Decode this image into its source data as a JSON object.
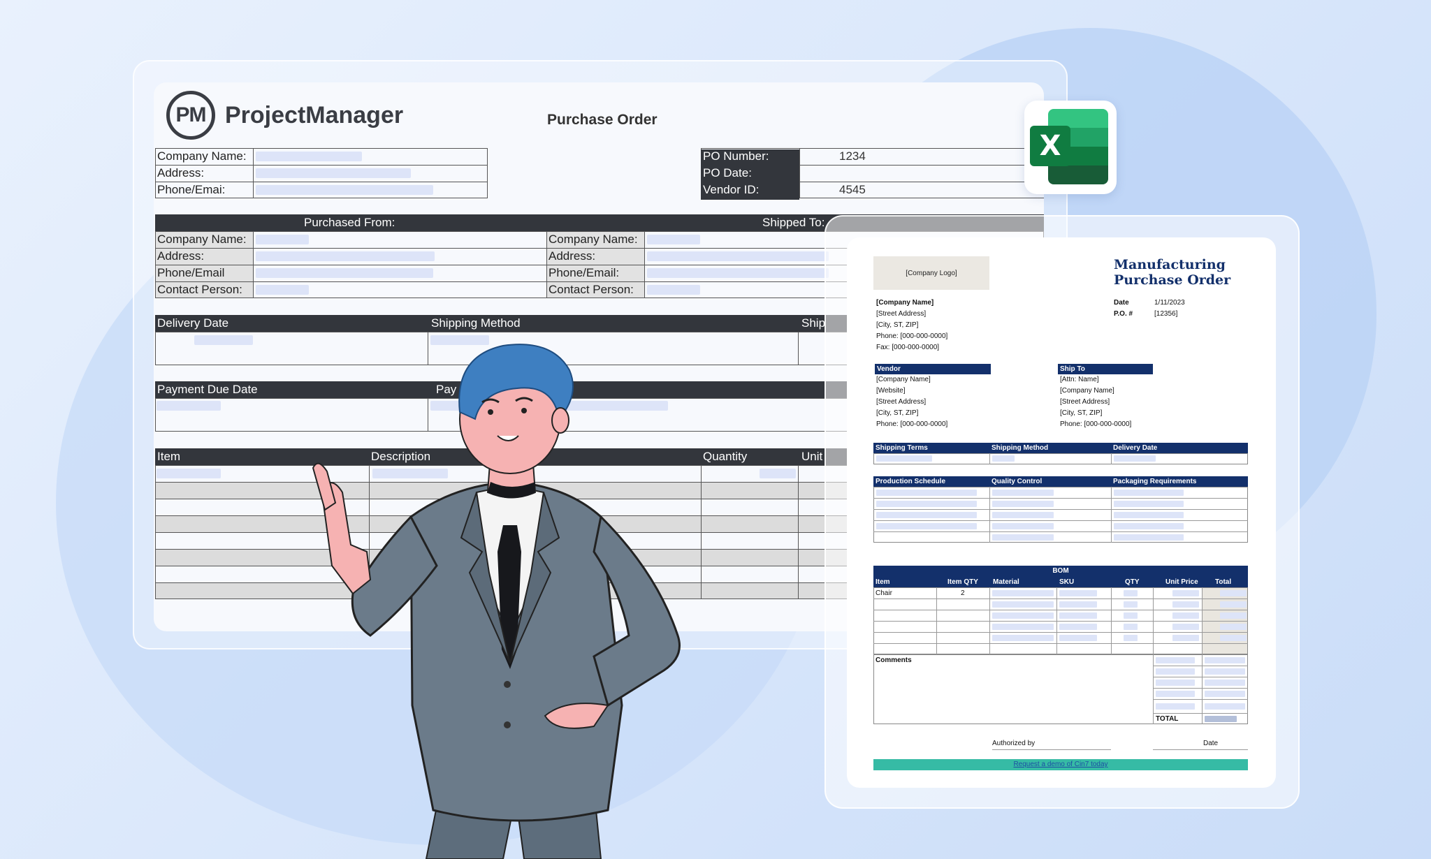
{
  "brand": {
    "logo_mark": "PM",
    "name": "ProjectManager"
  },
  "spreadsheet": {
    "title": "Purchase Order",
    "company_labels": [
      "Company Name:",
      "Address:",
      "Phone/Emai:"
    ],
    "po_labels": [
      "PO Number:",
      "PO Date:",
      "Vendor ID:"
    ],
    "po_values": [
      "1234",
      "",
      "4545"
    ],
    "purchased_from_header": "Purchased From:",
    "shipped_to_header": "Shipped To:",
    "purchased_from_labels": [
      "Company Name:",
      "Address:",
      "Phone/Email",
      "Contact Person:"
    ],
    "shipped_to_labels": [
      "Company Name:",
      "Address:",
      "Phone/Email:",
      "Contact Person:"
    ],
    "delivery_date_label": "Delivery Date",
    "shipping_method_label": "Shipping Method",
    "ship_partial_label": "Ship",
    "payment_due_label": "Payment Due Date",
    "payment_partial_label": "Pay",
    "item_label": "Item",
    "description_label": "Description",
    "quantity_label": "Quantity",
    "unit_partial_label": "Unit"
  },
  "app_icon": {
    "name": "excel-icon",
    "letter": "X"
  },
  "document": {
    "company_logo": "[Company Logo]",
    "title_line1": "Manufacturing",
    "title_line2": "Purchase Order",
    "company_lines": [
      "[Company Name]",
      "[Street Address]",
      "[City, ST, ZIP]",
      "Phone: [000-000-0000]",
      "Fax: [000-000-0000]"
    ],
    "date_label": "Date",
    "date_value": "1/11/2023",
    "po_label": "P.O. #",
    "po_value": "[12356]",
    "vendor_header": "Vendor",
    "vendor_lines": [
      "[Company Name]",
      "[Website]",
      "[Street Address]",
      "[City, ST, ZIP]",
      "Phone: [000-000-0000]"
    ],
    "ship_to_header": "Ship To",
    "ship_to_lines": [
      "[Attn: Name]",
      "[Company Name]",
      "[Street Address]",
      "[City, ST, ZIP]",
      "Phone: [000-000-0000]"
    ],
    "terms_headers": [
      "Shipping Terms",
      "Shipping Method",
      "Delivery Date"
    ],
    "production_headers": [
      "Production Schedule",
      "Quality Control",
      "Packaging Requirements"
    ],
    "bom_header": "BOM",
    "bom_columns": [
      "Item",
      "Item QTY",
      "Material",
      "SKU",
      "QTY",
      "Unit Price",
      "Total"
    ],
    "bom_first_item": "Chair",
    "bom_first_qty": "2",
    "comments_label": "Comments",
    "total_label": "TOTAL",
    "authorized_by_label": "Authorized by",
    "signature_date_label": "Date",
    "demo_link": "Request a demo of Cin7 today"
  },
  "colors": {
    "doc_navy": "#13306b",
    "sheet_dark": "#33363c",
    "accent_teal": "#36bba5",
    "placeholder": "#dde4f8"
  }
}
